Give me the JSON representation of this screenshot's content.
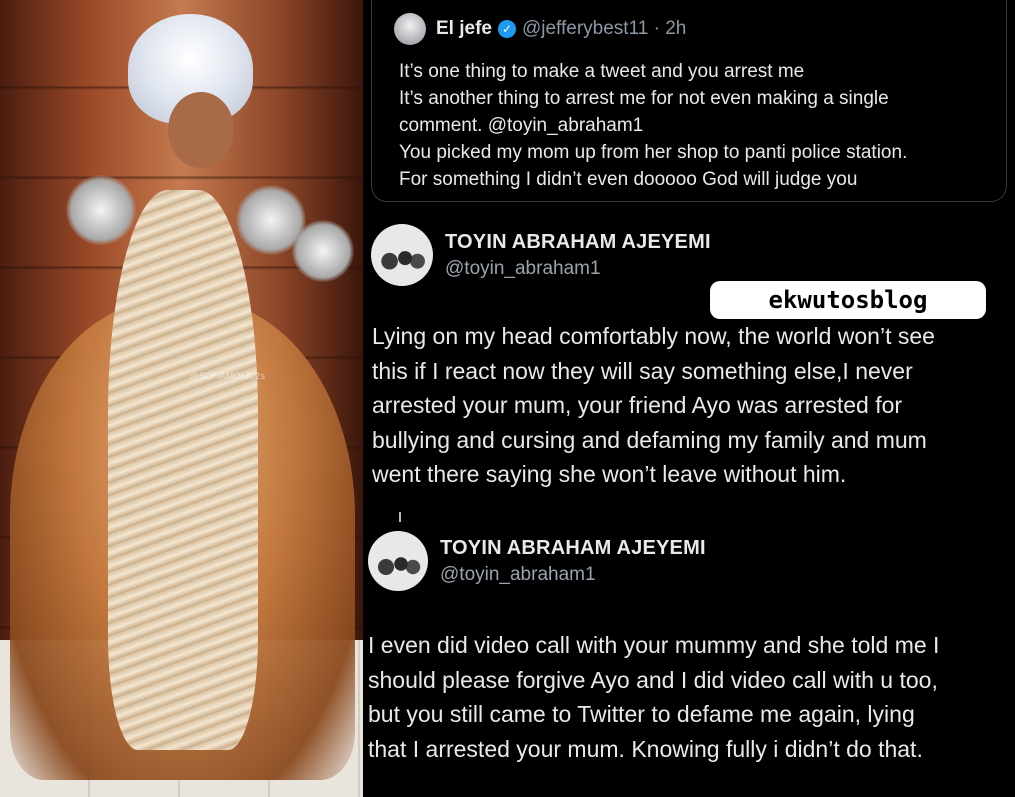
{
  "photo": {
    "watermark": "@SOFIAMOLA.2s"
  },
  "quote_tweet": {
    "name": "El jefe",
    "handle_time": "@jefferybest11 · 2h",
    "text": "It’s one thing to make a tweet and you arrest me\nIt’s another thing to arrest me for not even making a single\ncomment. @toyin_abraham1\nYou picked my mom up from her shop to panti police station.\nFor something I didn’t even dooooo God will judge you"
  },
  "tweet1": {
    "name": "TOYIN ABRAHAM AJEYEMI",
    "handle": "@toyin_abraham1",
    "text": "Lying on my head comfortably now, the world won’t see\nthis if I react now they will say something else,I never\narrested your mum, your friend Ayo was arrested for\nbullying and cursing and defaming my family and mum\nwent there saying she won’t leave without him."
  },
  "tweet2": {
    "name": "TOYIN ABRAHAM AJEYEMI",
    "handle": "@toyin_abraham1",
    "text": "I even did video call with your mummy and she told me I\nshould please forgive Ayo and I did video call with u too,\nbut you still came to Twitter to defame me again, lying\nthat I arrested your mum. Knowing fully i didn’t do that."
  },
  "watermark": {
    "label": "ekwutosblog"
  },
  "colors": {
    "accent_verified": "#1d9bf0",
    "text": "#e7e9ea",
    "muted": "#8b98a5",
    "background": "#000000"
  }
}
